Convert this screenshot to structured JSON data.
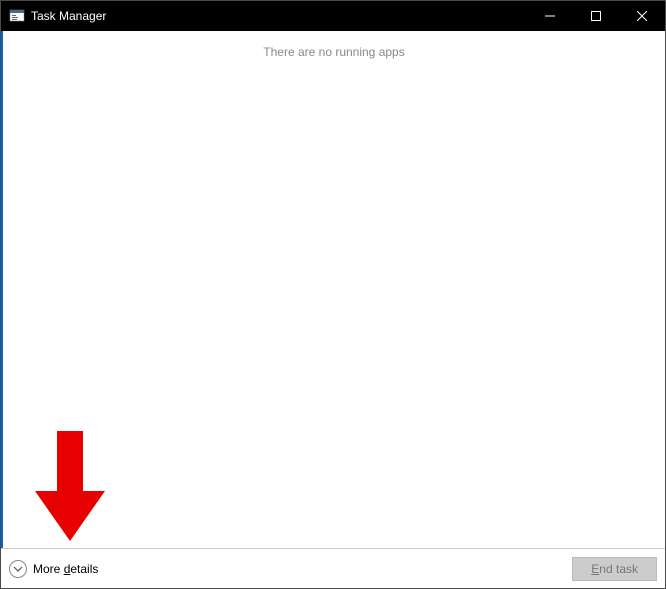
{
  "titlebar": {
    "title": "Task Manager"
  },
  "content": {
    "empty_message": "There are no running apps"
  },
  "footer": {
    "more_details_prefix": "More ",
    "more_details_ul": "d",
    "more_details_suffix": "etails",
    "end_task_ul": "E",
    "end_task_suffix": "nd task"
  }
}
